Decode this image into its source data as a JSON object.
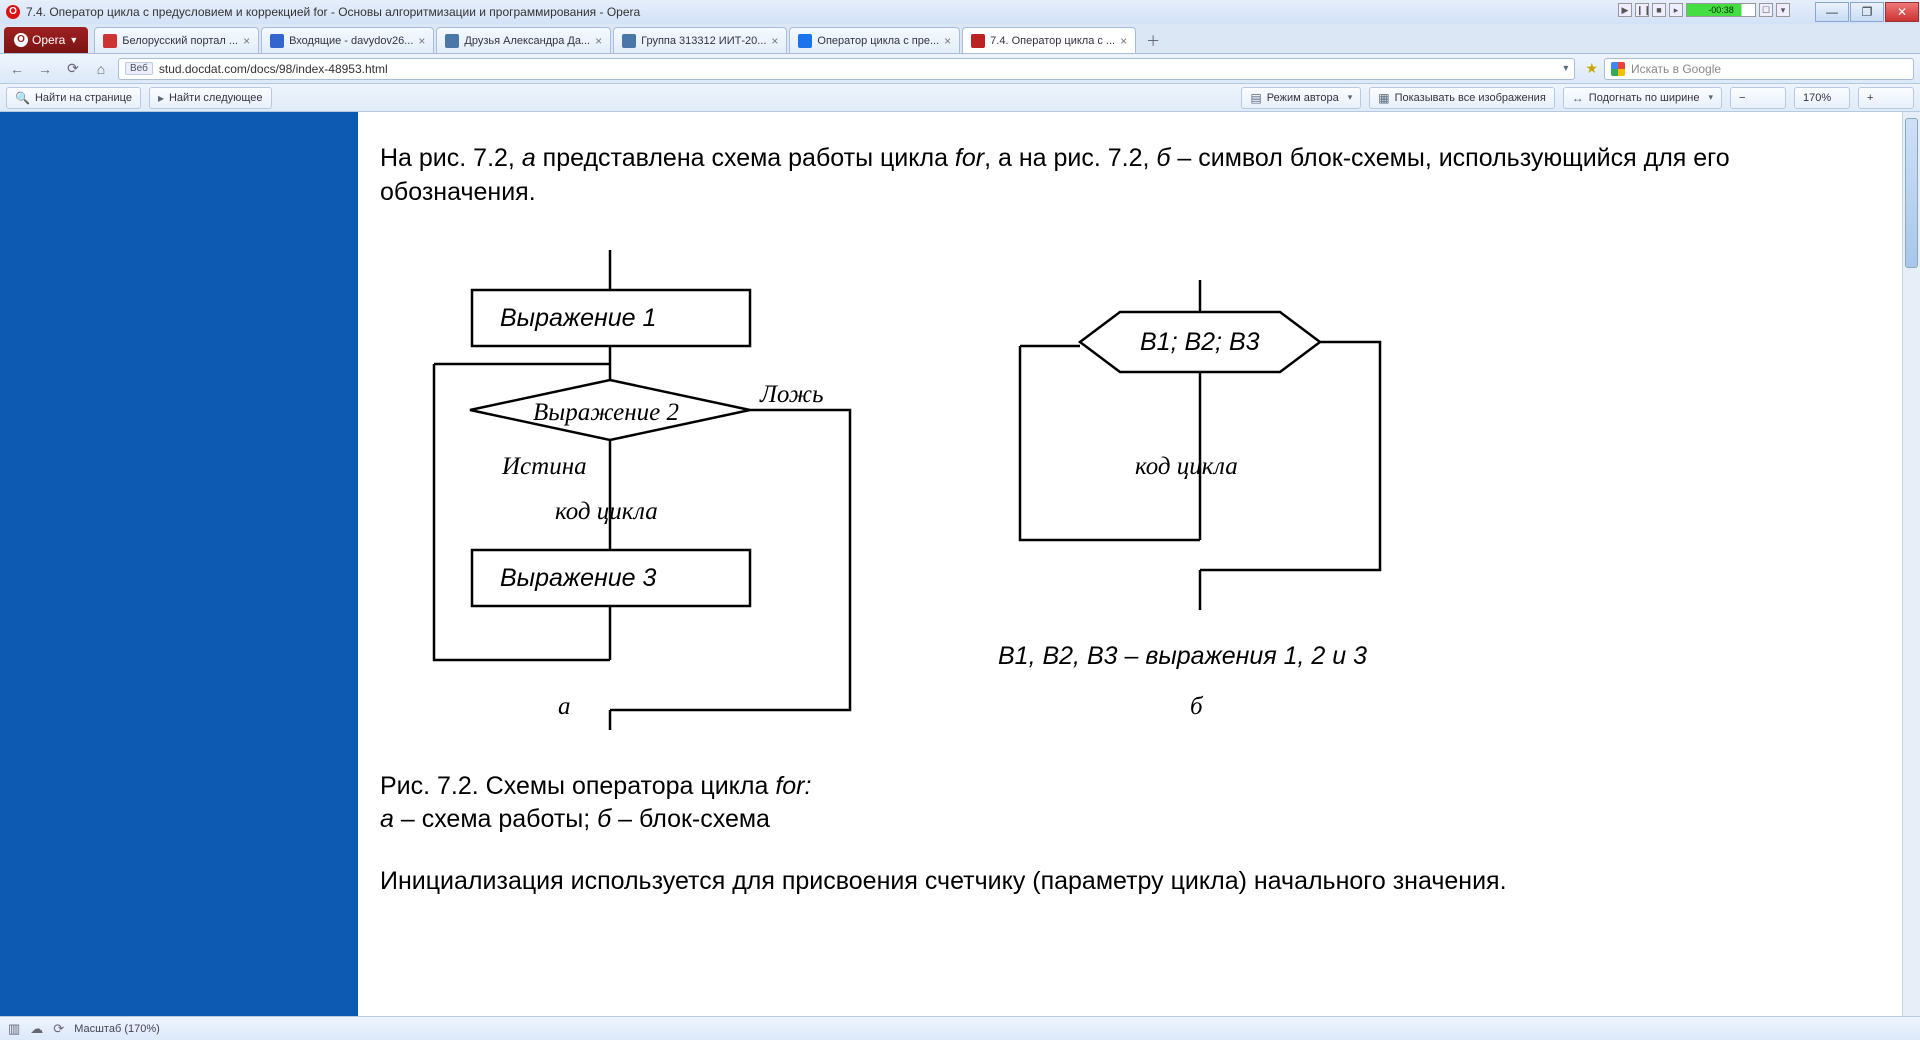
{
  "window": {
    "title": "7.4. Оператор цикла с предусловием и коррекцией for - Основы алгоритмизации и программирования - Opera"
  },
  "opera_btn": "Opera",
  "tabs": [
    {
      "label": "Белорусский портал ...",
      "favicon": "red"
    },
    {
      "label": "Входящие - davydov26...",
      "favicon": "blue"
    },
    {
      "label": "Друзья Александра Да...",
      "favicon": "vk"
    },
    {
      "label": "Группа 313312 ИИТ-20...",
      "favicon": "vk"
    },
    {
      "label": "Оператор цикла с пре...",
      "favicon": "g"
    },
    {
      "label": "7.4. Оператор цикла с ...",
      "favicon": "opera",
      "active": true
    }
  ],
  "address": {
    "badge": "Веб",
    "url": "stud.docdat.com/docs/98/index-48953.html"
  },
  "search": {
    "placeholder": "Искать в Google"
  },
  "findbar": {
    "find": "Найти на странице",
    "next": "Найти следующее"
  },
  "toolbar": {
    "author_mode": "Режим автора",
    "show_images": "Показывать все изображения",
    "fit_width": "Подогнать по ширине",
    "zoom": "170%"
  },
  "doc": {
    "p1a": "На рис. 7.2, ",
    "p1a_i": "а",
    "p1b": " представлена схема работы цикла ",
    "p1b_i": "for",
    "p1c": ", а на рис. 7.2, ",
    "p1c_i": "б",
    "p1d": " – символ блок-схемы, использующийся для его обозначения.",
    "fig": {
      "expr1": "Выражение 1",
      "expr2": "Выражение 2",
      "expr3": "Выражение 3",
      "true": "Истина",
      "false": "Ложь",
      "body": "код цикла",
      "hex": "B1; B2; B3",
      "body2": "код цикла",
      "legend": "B1, B2, B3 – выражения 1, 2 и 3",
      "label_a": "а",
      "label_b": "б"
    },
    "caption1": "Рис. 7.2. Схемы оператора цикла ",
    "caption1_i": "for:",
    "caption2a_i": "а",
    "caption2a": " – схема работы; ",
    "caption2b_i": "б",
    "caption2b": " – блок-схема",
    "p2": "Инициализация используется для присвоения счетчику (параметру цикла) начального значения."
  },
  "status": {
    "zoom": "Масштаб (170%)"
  }
}
